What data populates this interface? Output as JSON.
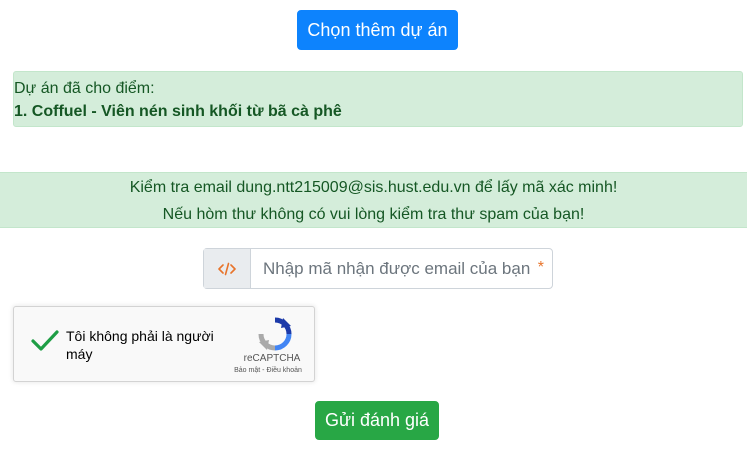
{
  "buttons": {
    "choose_more_projects": "Chọn thêm dự án",
    "submit_review": "Gửi đánh giá"
  },
  "graded_projects": {
    "label": "Dự án đã cho điểm:",
    "items": [
      "1. Coffuel - Viên nén sinh khối từ bã cà phê"
    ]
  },
  "email_notice": {
    "line1": "Kiểm tra email dung.ntt215009@sis.hust.edu.vn để lấy mã xác minh!",
    "line2": "Nếu hòm thư không có vui lòng kiểm tra thư spam của bạn!"
  },
  "verification": {
    "placeholder": "Nhập mã nhận được email của bạn",
    "value": "",
    "required_mark": "*",
    "prefix_icon": "code-icon"
  },
  "recaptcha": {
    "label": "Tôi không phải là người máy",
    "checked": true,
    "brand": "reCAPTCHA",
    "privacy": "Bảo mật",
    "separator": "-",
    "terms": "Điều khoản"
  },
  "colors": {
    "primary": "#0d83fd",
    "success": "#28a745",
    "alert_bg": "#d4edda",
    "alert_text": "#155724",
    "required": "#e8742b"
  }
}
